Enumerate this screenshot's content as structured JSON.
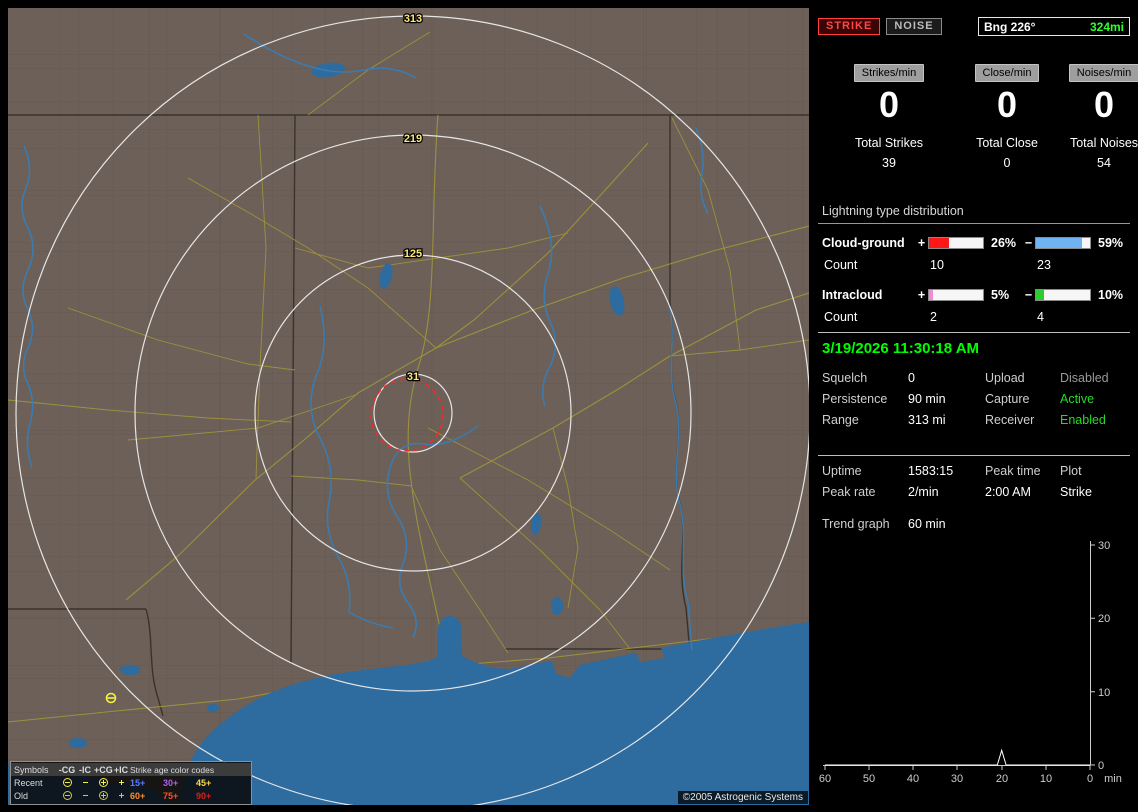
{
  "map": {
    "ring_labels": [
      "313",
      "219",
      "125",
      "31"
    ],
    "copyright": "©2005 Astrogenic Systems",
    "legend": {
      "title": "Symbols",
      "columns": [
        "-CG",
        "-IC",
        "+CG",
        "+IC"
      ],
      "age_title": "Strike age color codes",
      "rows": [
        {
          "label": "Recent",
          "symbol_color": "#f2ee4a",
          "ages": [
            {
              "text": "15+",
              "color": "#5a7dff"
            },
            {
              "text": "30+",
              "color": "#b05ef0"
            },
            {
              "text": "45+",
              "color": "#ffd84a"
            }
          ]
        },
        {
          "label": "Old",
          "symbol_color": "#cfc94a",
          "ages": [
            {
              "text": "60+",
              "color": "#ff8c2e"
            },
            {
              "text": "75+",
              "color": "#ff4e2e"
            },
            {
              "text": "90+",
              "color": "#e01c1c"
            }
          ]
        }
      ]
    }
  },
  "toolbar": {
    "strike": "STRIKE",
    "noise": "NOISE",
    "bearing": "Bng 226°",
    "distance": "324mi"
  },
  "rates": [
    {
      "label": "Strikes/min",
      "value": "0",
      "total_label": "Total Strikes",
      "total": "39"
    },
    {
      "label": "Close/min",
      "value": "0",
      "total_label": "Total Close",
      "total": "0"
    },
    {
      "label": "Noises/min",
      "value": "0",
      "total_label": "Total Noises",
      "total": "54"
    }
  ],
  "distribution": {
    "title": "Lightning type distribution",
    "count_label": "Count",
    "plus_sign": "+",
    "minus_sign": "−",
    "rows": [
      {
        "label": "Cloud-ground",
        "plus": {
          "pct": 26,
          "pct_label": "26%",
          "count": "10",
          "color": "#ff1616"
        },
        "minus": {
          "pct": 59,
          "pct_label": "59%",
          "count": "23",
          "color": "#6fb3f2"
        }
      },
      {
        "label": "Intracloud",
        "plus": {
          "pct": 5,
          "pct_label": "5%",
          "count": "2",
          "color": "#f08ad2"
        },
        "minus": {
          "pct": 10,
          "pct_label": "10%",
          "count": "4",
          "color": "#2ecc2e"
        }
      }
    ]
  },
  "status": {
    "timestamp": "3/19/2026 11:30:18 AM",
    "left": [
      {
        "label": "Squelch",
        "value": "0"
      },
      {
        "label": "Persistence",
        "value": "90 min"
      },
      {
        "label": "Range",
        "value": "313 mi"
      }
    ],
    "right": [
      {
        "label": "Upload",
        "value": "Disabled",
        "color": "#9a9a9a"
      },
      {
        "label": "Capture",
        "value": "Active",
        "color": "#22dd22"
      },
      {
        "label": "Receiver",
        "value": "Enabled",
        "color": "#22dd22"
      }
    ]
  },
  "stats": {
    "rows": [
      {
        "c1": "Uptime",
        "c2": "1583:15",
        "c3": "Peak time",
        "c4": "Plot"
      },
      {
        "c1": "Peak rate",
        "c2": "2/min",
        "c3": "2:00 AM",
        "c4": "Strike"
      }
    ],
    "trend_label": "Trend graph",
    "trend_window": "60 min"
  },
  "chart_data": {
    "type": "line",
    "title": "Strike rate trend (last 60 min)",
    "xlabel": "min",
    "x_ticks": [
      60,
      50,
      40,
      30,
      20,
      10,
      0
    ],
    "y_ticks": [
      0,
      10,
      20,
      30
    ],
    "ylim": [
      0,
      30
    ],
    "grid": false,
    "series": [
      {
        "name": "Strike",
        "points": [
          [
            60,
            0
          ],
          [
            25,
            0
          ],
          [
            21,
            0
          ],
          [
            20,
            2
          ],
          [
            19,
            0
          ],
          [
            0,
            0
          ]
        ]
      }
    ]
  }
}
